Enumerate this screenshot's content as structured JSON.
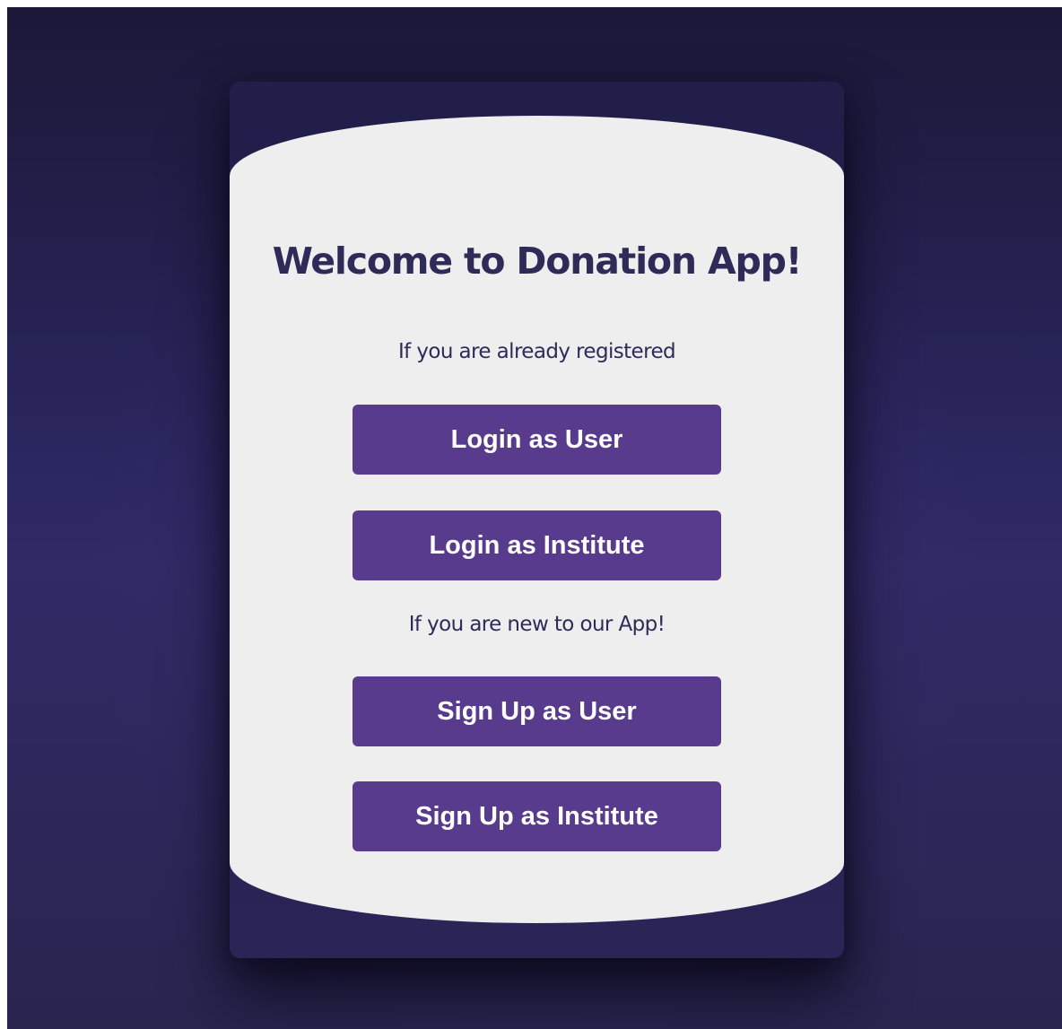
{
  "colors": {
    "background": "#2b2760",
    "card": "#221e4a",
    "panel": "#eeeeef",
    "text": "#2f2b58",
    "button": "#583b8c",
    "button_text": "#ffffff"
  },
  "welcome": {
    "title": "Welcome to Donation App!",
    "registered_prompt": "If you are already registered",
    "new_prompt": "If you are new to our App!"
  },
  "buttons": {
    "login_user": "Login as User",
    "login_institute": "Login as Institute",
    "signup_user": "Sign Up as User",
    "signup_institute": "Sign Up as Institute"
  }
}
